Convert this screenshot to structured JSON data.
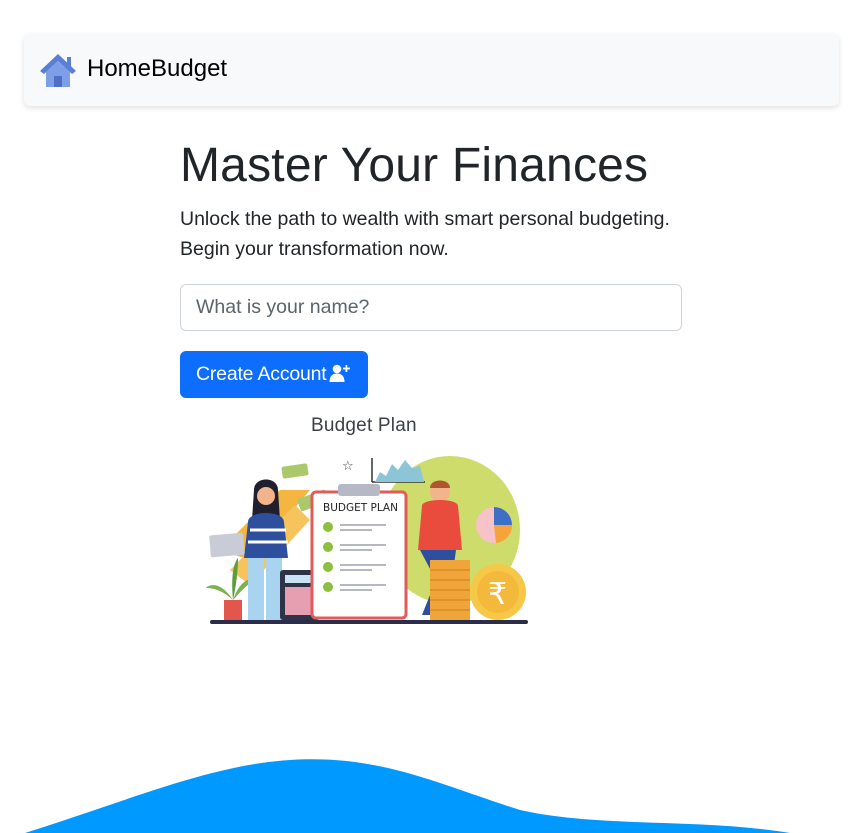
{
  "navbar": {
    "brand_name": "HomeBudget",
    "brand_icon": "house-icon"
  },
  "hero": {
    "title": "Master Your Finances",
    "lead_line1": "Unlock the path to wealth with smart personal budgeting.",
    "lead_line2": "Begin your transformation now.",
    "name_placeholder": "What is your name?",
    "name_value": "",
    "create_button_label": "Create Account",
    "create_button_icon": "user-plus-icon"
  },
  "illustration": {
    "title": "Budget Plan",
    "clipboard_heading": "BUDGET PLAN",
    "coin_symbol": "₹"
  },
  "colors": {
    "primary": "#0d6efd",
    "navbar_bg": "#f8f9fa",
    "wave": "#0099ff",
    "house_icon": "#6c8fe0"
  }
}
